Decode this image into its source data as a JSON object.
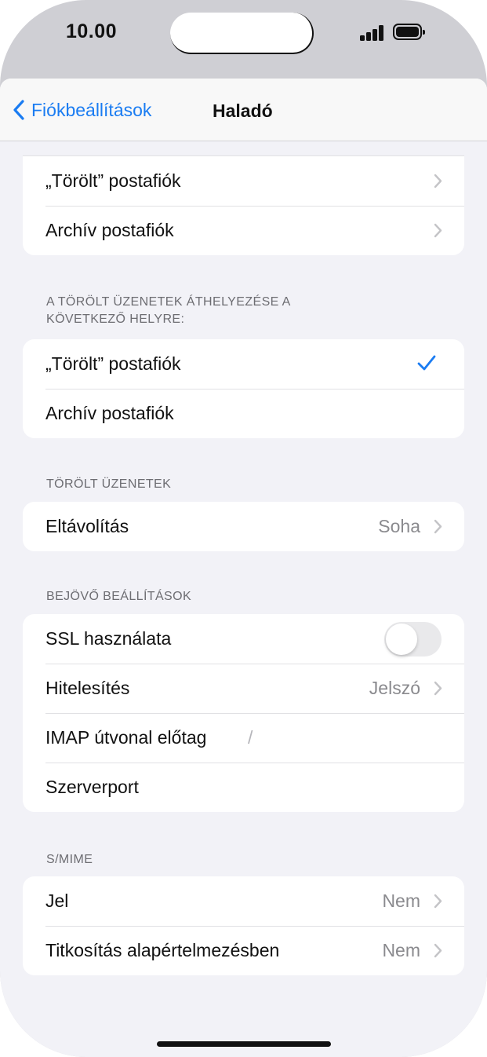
{
  "status": {
    "time": "10.00"
  },
  "nav": {
    "back_label": "Fiókbeállítások",
    "title": "Haladó"
  },
  "group1": {
    "rows": [
      {
        "label": "„Törölt” postafiók"
      },
      {
        "label": "Archív postafiók"
      }
    ]
  },
  "move_section": {
    "header_line1": "A TÖRÖLT ÜZENETEK ÁTHELYEZÉSE A",
    "header_line2": "KÖVETKEZŐ HELYRE:",
    "rows": [
      {
        "label": "„Törölt” postafiók",
        "selected": true
      },
      {
        "label": "Archív postafiók",
        "selected": false
      }
    ]
  },
  "deleted_section": {
    "header": "TÖRÖLT ÜZENETEK",
    "rows": [
      {
        "label": "Eltávolítás",
        "value": "Soha"
      }
    ]
  },
  "incoming_section": {
    "header": "BEJÖVŐ BEÁLLÍTÁSOK",
    "rows": [
      {
        "label": "SSL használata",
        "toggle_on": false
      },
      {
        "label": "Hitelesítés",
        "value": "Jelszó"
      },
      {
        "label": "IMAP útvonal előtag",
        "value": "/"
      },
      {
        "label": "Szerverport"
      }
    ]
  },
  "smime_section": {
    "header": "S/MIME",
    "rows": [
      {
        "label": "Jel",
        "value": "Nem"
      },
      {
        "label": "Titkosítás alapértelmezésben",
        "value": "Nem"
      }
    ]
  },
  "colors": {
    "accent": "#1a7cf2",
    "background": "#f2f2f7",
    "secondary_text": "#8a8a8e"
  }
}
